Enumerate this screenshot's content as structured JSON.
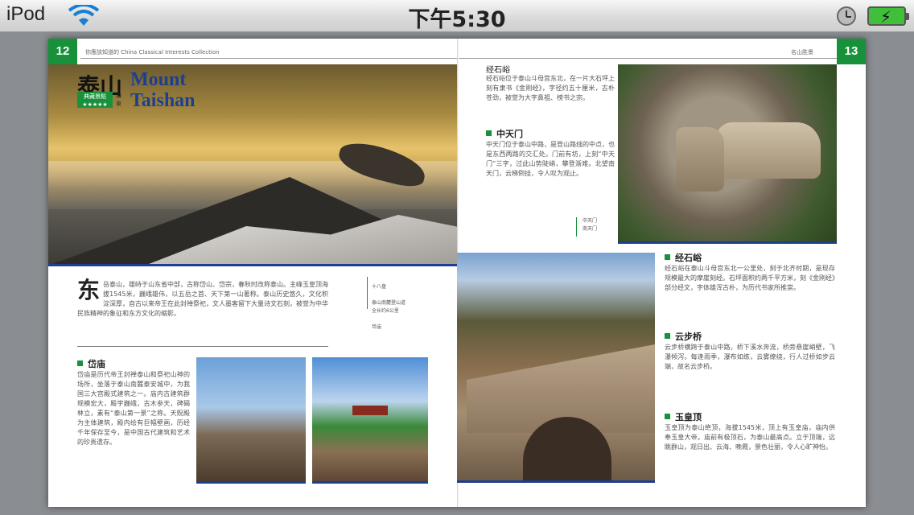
{
  "status_bar": {
    "carrier": "iPod",
    "time": "下午5:30",
    "icons": [
      "wifi-icon",
      "alarm-icon",
      "battery-charging-icon"
    ]
  },
  "book": {
    "left_page": {
      "page_number": "12",
      "running_head": "你應該知道的 China Classical Interests Collection",
      "title_zh": "泰山",
      "title_en_line1": "Mount",
      "title_en_line2": "Taishan",
      "badge": "典藏景點 ★★★★★",
      "badge_side": "山東",
      "intro_dropcap": "东",
      "intro_text": "岳泰山，雄峙于山东省中部，古称岱山、岱宗，春秋时改称泰山。主峰玉皇顶海拔1545米，巍峨雄伟，以五岳之首、天下第一山著称。泰山历史悠久，文化积淀深厚，自古以来帝王在此封禅祭祀，文人墨客留下大量诗文石刻，被誉为中华民族精神的象征和东方文化的缩影。",
      "legend": [
        "十八盘",
        "泰山南麓登山道\n全长约6公里",
        "岱庙"
      ],
      "section_title": "岱庙",
      "section_text": "岱庙是历代帝王封禅泰山和祭祀山神的场所，坐落于泰山南麓泰安城中，为我国三大宫殿式建筑之一。庙内古建筑群规模宏大，殿宇巍峨，古木参天，碑碣林立，素有“泰山第一景”之称。天贶殿为主体建筑，殿内绘有巨幅壁画，历经千年保存至今，是中国古代建筑和艺术的珍贵遗存。"
    },
    "right_page": {
      "page_number": "13",
      "running_head": "名山胜景",
      "top_section_title": "经石峪",
      "top_section_text": "经石峪位于泰山斗母宫东北，在一片大石坪上刻有隶书《金刚经》，字径约五十厘米，古朴苍劲，被誉为大字鼻祖、榜书之宗。",
      "zhongtianmen_title": "中天门",
      "zhongtianmen_text": "中天门位于泰山中路，是登山路线的中点，也是东西两路的交汇处。门前有坊，上刻“中天门”三字，过此山势陡峭，攀登渐难。北望南天门，云梯倒挂，令人叹为观止。",
      "legend": [
        "中天门",
        "南天门"
      ],
      "jingshiyu_title": "经石峪",
      "jingshiyu_text": "经石峪在泰山斗母宫东北一公里处，刻于北齐时期，是现存规模最大的摩崖刻经。石坪面积约两千平方米，刻《金刚经》部分经文，字体雄浑古朴，为历代书家所推崇。",
      "yunbuqiao_title": "云步桥",
      "yunbuqiao_text": "云步桥横跨于泰山中路，桥下溪水奔流，桥旁悬崖峭壁，飞瀑倾泻。每逢雨季，瀑布如练，云雾缭绕，行人过桥如步云端，故名云步桥。",
      "yuhuangding_title": "玉皇顶",
      "yuhuangding_text": "玉皇顶为泰山绝顶，海拔1545米，顶上有玉皇庙，庙内供奉玉皇大帝。庙前有极顶石，为泰山最高点。立于顶端，远眺群山，观日出、云海、晚霞，景色壮丽，令人心旷神怡。"
    }
  }
}
